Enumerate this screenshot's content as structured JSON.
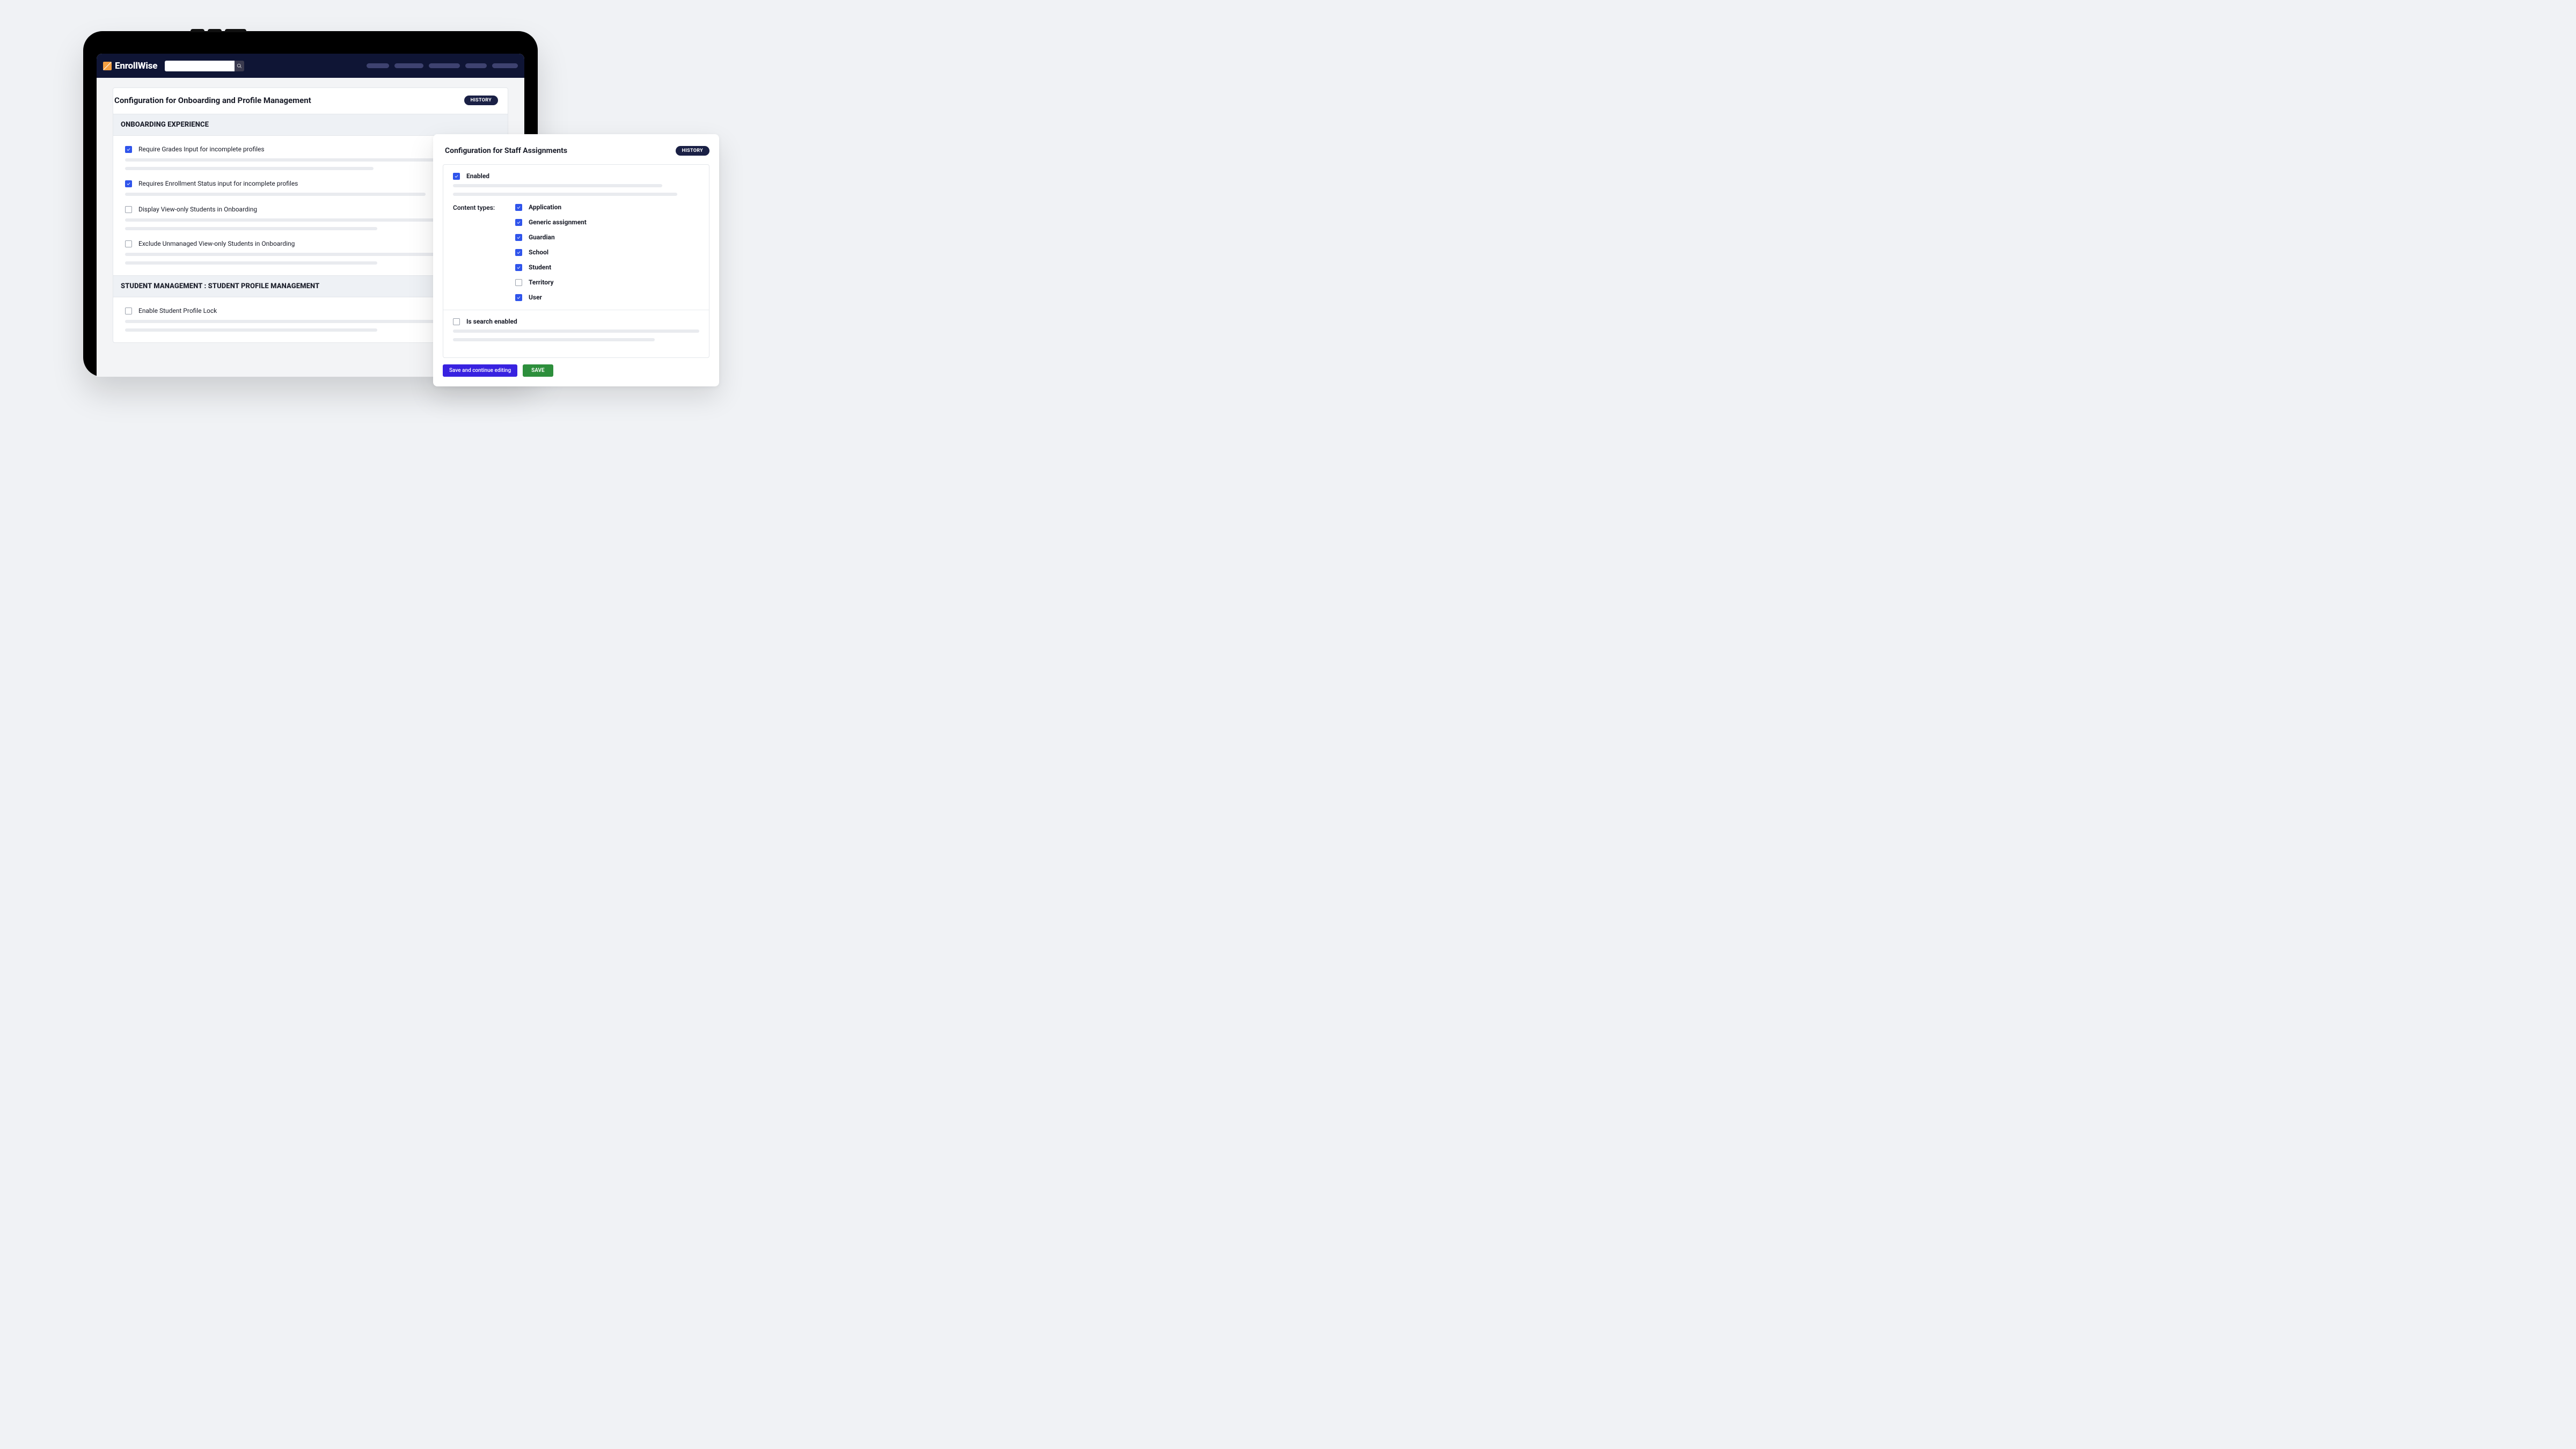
{
  "brand": "EnrollWise",
  "search": {
    "placeholder": ""
  },
  "main": {
    "title": "Configuration for Onboarding and Profile Management",
    "history_label": "HISTORY",
    "sections": [
      {
        "title": "ONBOARDING EXPERIENCE",
        "options": [
          {
            "label": "Require Grades Input for incomplete profiles",
            "checked": true,
            "lines": [
              100,
              67
            ]
          },
          {
            "label": "Requires Enrollment Status input for incomplete profiles",
            "checked": true,
            "lines": [
              81
            ]
          },
          {
            "label": "Display View-only Students in Onboarding",
            "checked": false,
            "lines": [
              100,
              68
            ]
          },
          {
            "label": "Exclude Unmanaged View-only Students in Onboarding",
            "checked": false,
            "lines": [
              100,
              68
            ]
          }
        ]
      },
      {
        "title": "STUDENT MANAGEMENT : STUDENT PROFILE MANAGEMENT",
        "options": [
          {
            "label": "Enable Student Profile Lock",
            "checked": false,
            "lines": [
              100,
              68
            ]
          }
        ]
      }
    ]
  },
  "staff": {
    "title": "Configuration for Staff Assignments",
    "history_label": "HISTORY",
    "enabled": {
      "label": "Enabled",
      "checked": true,
      "lines": [
        85,
        91
      ]
    },
    "content_types_label": "Content types:",
    "content_types": [
      {
        "label": "Application",
        "checked": true
      },
      {
        "label": "Generic assignment",
        "checked": true
      },
      {
        "label": "Guardian",
        "checked": true
      },
      {
        "label": "School",
        "checked": true
      },
      {
        "label": "Student",
        "checked": true
      },
      {
        "label": "Territory",
        "checked": false
      },
      {
        "label": "User",
        "checked": true
      }
    ],
    "search_enabled": {
      "label": "Is search enabled",
      "checked": false,
      "lines": [
        100,
        82
      ]
    },
    "save_continue_label": "Save and continue editing",
    "save_label": "SAVE"
  }
}
